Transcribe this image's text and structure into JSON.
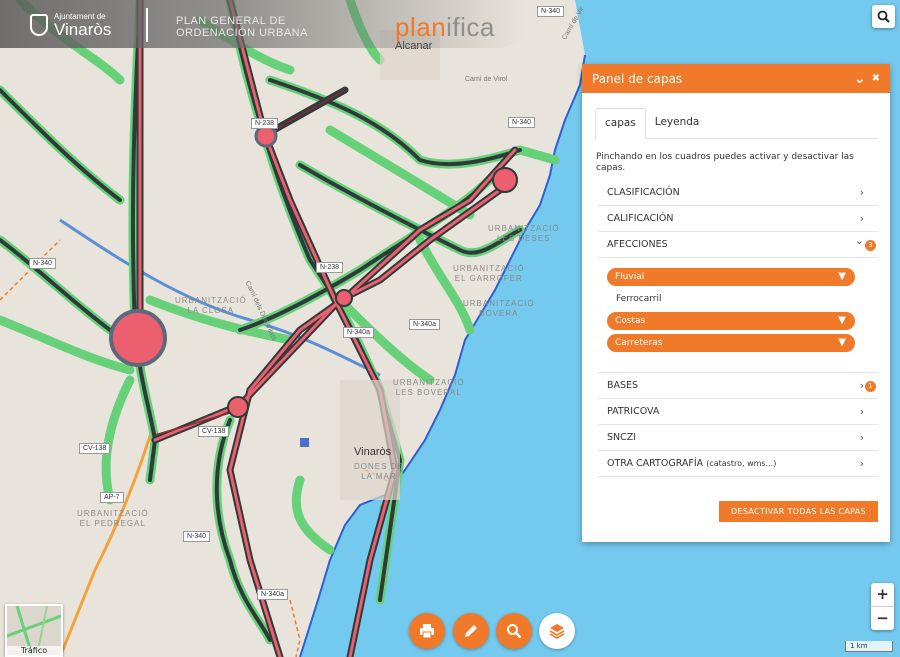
{
  "header": {
    "logo_small": "Ajuntament de",
    "logo_big": "Vinaròs",
    "title_line1": "PLAN GENERAL DE",
    "title_line2": "ORDENACIÓN URBANA",
    "brand_part1": "plan",
    "brand_part2": "ifica"
  },
  "map": {
    "towns": {
      "alcanar": "Alcanar",
      "vinaros": "Vinaròs"
    },
    "areas": {
      "la_closa": [
        "URBANITZACIÓ",
        "LA CLOSA"
      ],
      "el_pedregal": [
        "URBANITZACIÓ",
        "EL PEDREGAL"
      ],
      "les_deses": [
        "URBANITZACIÓ",
        "LES DESES"
      ],
      "el_garrofer": [
        "URBANITZACIÓ",
        "EL GARROFER"
      ],
      "bovera": [
        "URBANITZACIÓ",
        "BOVERA"
      ],
      "les_boveral": [
        "URBANITZACIÓ",
        "LES BOVERAL"
      ],
      "dones": [
        "DONES DE",
        "LA MAR"
      ]
    },
    "streets": {
      "cami_virol": "Camí de Virol",
      "cami_virol2": "Camí de Vir",
      "cami_dos_vilars": "Camí dels Dos Vilars"
    },
    "roads": [
      "N-340",
      "N-340",
      "N-238",
      "N-238",
      "N-340",
      "N-340a",
      "N-340a",
      "CV-138",
      "CV-138",
      "AP-7",
      "N-340",
      "N-340a"
    ]
  },
  "panel": {
    "title": "Panel de capas",
    "collapse_symbol": "⌄",
    "close_symbol": "✖",
    "tabs": [
      "capas",
      "Leyenda"
    ],
    "intro": "Pinchando en los cuadros puedes activar y desactivar las capas.",
    "categories": [
      {
        "label": "CLASIFICACIÓN",
        "chevron": "›"
      },
      {
        "label": "CALIFICACIÓN",
        "chevron": "›"
      },
      {
        "label": "AFECCIONES",
        "chevron": "⌄",
        "badge": "3"
      }
    ],
    "afecciones_layers": [
      {
        "label": "Fluvial",
        "active": true
      },
      {
        "label": "Ferrocarril",
        "active": false
      },
      {
        "label": "Costas",
        "active": true
      },
      {
        "label": "Carreteras",
        "active": true
      }
    ],
    "dropdown_symbol": "▼",
    "categories2": [
      {
        "label": "BASES",
        "chevron": "›",
        "badge": "1"
      },
      {
        "label": "PATRICOVA",
        "chevron": "›"
      },
      {
        "label": "SNCZI",
        "chevron": "›"
      },
      {
        "label": "OTRA CARTOGRAFÍA",
        "note": "(catastro, wms...)",
        "chevron": "›"
      }
    ],
    "deactivate_label": "DESACTIVAR TODAS LAS CAPAS"
  },
  "controls": {
    "zoom_in": "+",
    "zoom_out": "−",
    "scale": "1 km",
    "traffic": "Tráfico"
  },
  "tools": [
    "printer-icon",
    "pencil-icon",
    "search-icon",
    "layers-icon"
  ],
  "colors": {
    "accent": "#f07a2a",
    "road_green": "#67d17a",
    "road_red": "#ec5f6e",
    "sea": "#74c9ee",
    "coast": "#2f5fd1"
  }
}
